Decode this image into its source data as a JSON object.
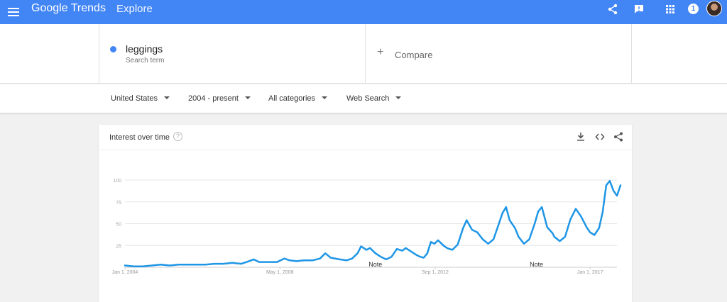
{
  "app": {
    "logo": "Google Trends",
    "section": "Explore",
    "notifications": "1"
  },
  "search": {
    "term": "leggings",
    "term_type": "Search term",
    "compare_label": "Compare",
    "term_color": "#4285f4"
  },
  "filters": {
    "region": "United States",
    "time": "2004 - present",
    "category": "All categories",
    "property": "Web Search"
  },
  "card": {
    "title": "Interest over time",
    "help": "?"
  },
  "chart_data": {
    "type": "line",
    "title": "",
    "xlabel": "",
    "ylabel": "",
    "x_range": [
      2004.0,
      2017.75
    ],
    "ylim": [
      0,
      100
    ],
    "yticks": [
      25,
      50,
      75,
      100
    ],
    "xticks": [
      {
        "value": 2004.0,
        "label": "Jan 1, 2004"
      },
      {
        "value": 2008.33,
        "label": "May 1, 2008"
      },
      {
        "value": 2012.67,
        "label": "Sep 1, 2012"
      },
      {
        "value": 2017.0,
        "label": "Jan 1, 2017"
      }
    ],
    "annotations": [
      {
        "x": 2011.0,
        "label": "Note"
      },
      {
        "x": 2015.5,
        "label": "Note"
      }
    ],
    "grid": true,
    "series": [
      {
        "color": "#1e96e6",
        "points": [
          [
            2004.0,
            2
          ],
          [
            2004.25,
            1
          ],
          [
            2004.5,
            1
          ],
          [
            2004.75,
            2
          ],
          [
            2005.0,
            3
          ],
          [
            2005.25,
            2
          ],
          [
            2005.5,
            3
          ],
          [
            2005.75,
            3
          ],
          [
            2006.0,
            3
          ],
          [
            2006.25,
            3
          ],
          [
            2006.5,
            4
          ],
          [
            2006.75,
            4
          ],
          [
            2007.0,
            5
          ],
          [
            2007.25,
            4
          ],
          [
            2007.4,
            6
          ],
          [
            2007.6,
            9
          ],
          [
            2007.75,
            6
          ],
          [
            2008.0,
            6
          ],
          [
            2008.25,
            6
          ],
          [
            2008.45,
            10
          ],
          [
            2008.6,
            8
          ],
          [
            2008.8,
            7
          ],
          [
            2009.0,
            8
          ],
          [
            2009.25,
            8
          ],
          [
            2009.45,
            10
          ],
          [
            2009.6,
            16
          ],
          [
            2009.75,
            11
          ],
          [
            2010.0,
            9
          ],
          [
            2010.2,
            8
          ],
          [
            2010.35,
            10
          ],
          [
            2010.5,
            16
          ],
          [
            2010.6,
            24
          ],
          [
            2010.75,
            20
          ],
          [
            2010.85,
            22
          ],
          [
            2011.0,
            16
          ],
          [
            2011.15,
            12
          ],
          [
            2011.3,
            9
          ],
          [
            2011.45,
            12
          ],
          [
            2011.6,
            21
          ],
          [
            2011.75,
            19
          ],
          [
            2011.85,
            22
          ],
          [
            2012.0,
            18
          ],
          [
            2012.15,
            14
          ],
          [
            2012.25,
            12
          ],
          [
            2012.35,
            11
          ],
          [
            2012.45,
            16
          ],
          [
            2012.55,
            29
          ],
          [
            2012.65,
            27
          ],
          [
            2012.75,
            31
          ],
          [
            2012.9,
            25
          ],
          [
            2013.0,
            22
          ],
          [
            2013.15,
            20
          ],
          [
            2013.3,
            26
          ],
          [
            2013.45,
            45
          ],
          [
            2013.55,
            54
          ],
          [
            2013.7,
            43
          ],
          [
            2013.85,
            40
          ],
          [
            2014.0,
            32
          ],
          [
            2014.15,
            27
          ],
          [
            2014.3,
            32
          ],
          [
            2014.45,
            50
          ],
          [
            2014.55,
            62
          ],
          [
            2014.65,
            69
          ],
          [
            2014.75,
            54
          ],
          [
            2014.9,
            45
          ],
          [
            2015.0,
            35
          ],
          [
            2015.15,
            27
          ],
          [
            2015.3,
            32
          ],
          [
            2015.45,
            50
          ],
          [
            2015.55,
            64
          ],
          [
            2015.65,
            69
          ],
          [
            2015.8,
            46
          ],
          [
            2015.95,
            39
          ],
          [
            2016.0,
            35
          ],
          [
            2016.15,
            30
          ],
          [
            2016.3,
            35
          ],
          [
            2016.45,
            55
          ],
          [
            2016.6,
            67
          ],
          [
            2016.75,
            58
          ],
          [
            2016.9,
            46
          ],
          [
            2017.0,
            40
          ],
          [
            2017.12,
            37
          ],
          [
            2017.25,
            45
          ],
          [
            2017.35,
            63
          ],
          [
            2017.45,
            94
          ],
          [
            2017.55,
            99
          ],
          [
            2017.65,
            88
          ],
          [
            2017.75,
            82
          ],
          [
            2017.85,
            94
          ]
        ]
      }
    ]
  }
}
